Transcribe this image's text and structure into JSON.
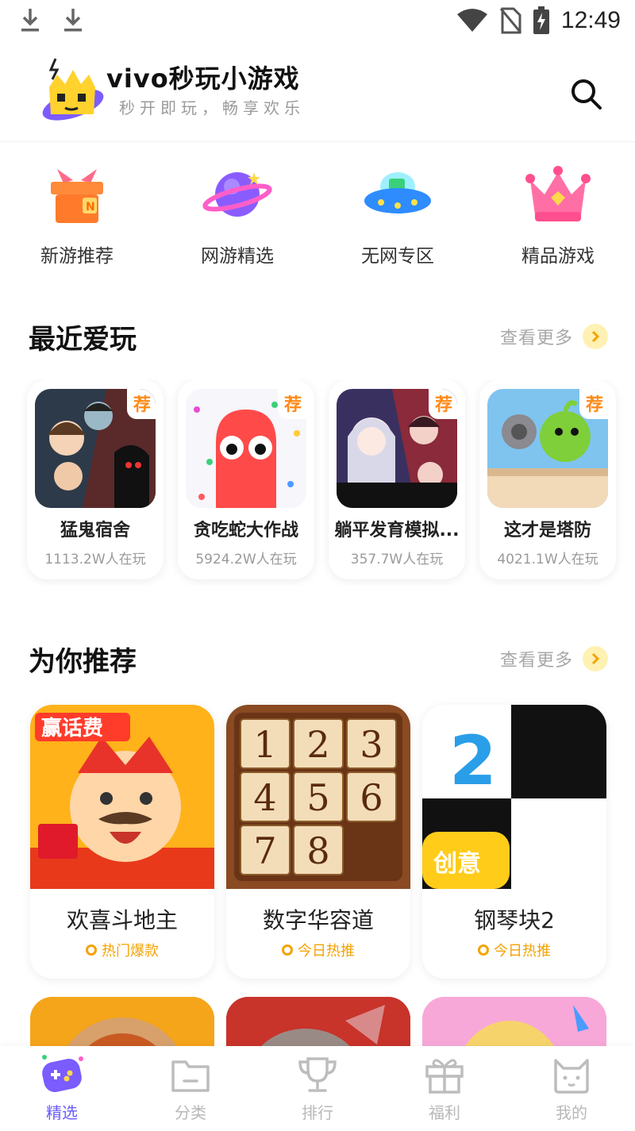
{
  "status_bar": {
    "time": "12:49",
    "icons": [
      "download-icon",
      "download-icon",
      "wifi-icon",
      "no-sim-icon",
      "battery-charging-icon"
    ]
  },
  "app": {
    "title": "vivo秒玩小游戏",
    "subtitle": "秒开即玩，畅享欢乐",
    "logo_icon": "crown-cat-logo",
    "search_icon": "search-icon"
  },
  "categories": [
    {
      "label": "新游推荐",
      "icon": "gift-box-icon"
    },
    {
      "label": "网游精选",
      "icon": "planet-icon"
    },
    {
      "label": "无网专区",
      "icon": "ufo-icon"
    },
    {
      "label": "精品游戏",
      "icon": "crown-icon"
    }
  ],
  "recent": {
    "title": "最近爱玩",
    "more_label": "查看更多",
    "tag": "荐",
    "games": [
      {
        "name": "猛鬼宿舍",
        "players": "1113.2W人在玩"
      },
      {
        "name": "贪吃蛇大作战",
        "players": "5924.2W人在玩"
      },
      {
        "name": "躺平发育模拟...",
        "players": "357.7W人在玩"
      },
      {
        "name": "这才是塔防",
        "players": "4021.1W人在玩"
      }
    ]
  },
  "recommend": {
    "title": "为你推荐",
    "more_label": "查看更多",
    "games": [
      {
        "name": "欢喜斗地主",
        "badge": "热门爆款",
        "thumb_text": "赢话费"
      },
      {
        "name": "数字华容道",
        "badge": "今日热推",
        "thumb_digits": [
          "1",
          "2",
          "3",
          "4",
          "5",
          "6",
          "7",
          "8"
        ]
      },
      {
        "name": "钢琴块2",
        "badge": "今日热推",
        "thumb_number": "2",
        "thumb_tag": "创意"
      }
    ]
  },
  "bottom_nav": [
    {
      "label": "精选",
      "icon": "gamepad-icon",
      "active": true
    },
    {
      "label": "分类",
      "icon": "folder-icon",
      "active": false
    },
    {
      "label": "排行",
      "icon": "trophy-icon",
      "active": false
    },
    {
      "label": "福利",
      "icon": "gift-icon",
      "active": false
    },
    {
      "label": "我的",
      "icon": "cat-face-icon",
      "active": false
    }
  ],
  "colors": {
    "accent_purple": "#6a5cff",
    "tag_orange": "#ff8a1a",
    "badge_gold": "#f5a300",
    "more_arrow_bg": "#fff1b3"
  }
}
